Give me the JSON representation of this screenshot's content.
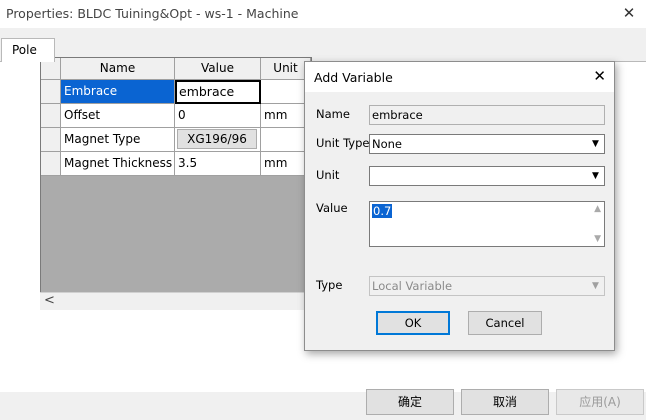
{
  "window": {
    "title": "Properties: BLDC Tuining&Opt - ws-1 - Machine",
    "close_glyph": "✕"
  },
  "tab": {
    "label": "Pole"
  },
  "grid": {
    "headers": [
      "Name",
      "Value",
      "Unit"
    ],
    "rows": [
      {
        "name": "Embrace",
        "value": "embrace",
        "unit": ""
      },
      {
        "name": "Offset",
        "value": "0",
        "unit": "mm"
      },
      {
        "name": "Magnet Type",
        "value": "XG196/96",
        "unit": ""
      },
      {
        "name": "Magnet Thickness",
        "value": "3.5",
        "unit": "mm"
      }
    ]
  },
  "scroll": {
    "left_arrow": "<"
  },
  "buttons": {
    "ok": "确定",
    "cancel": "取消",
    "apply": "应用(A)"
  },
  "dialog": {
    "title": "Add Variable",
    "close_glyph": "✕",
    "name_label": "Name",
    "name_value": "embrace",
    "unit_type_label": "Unit Type",
    "unit_type_value": "None",
    "unit_label": "Unit",
    "unit_value": "",
    "value_label": "Value",
    "value_value": "0.7",
    "type_label": "Type",
    "type_value": "Local Variable",
    "ok_label": "OK",
    "cancel_label": "Cancel"
  },
  "colors": {
    "selection": "#0a64d2",
    "window_bg": "#f0f0f0"
  }
}
